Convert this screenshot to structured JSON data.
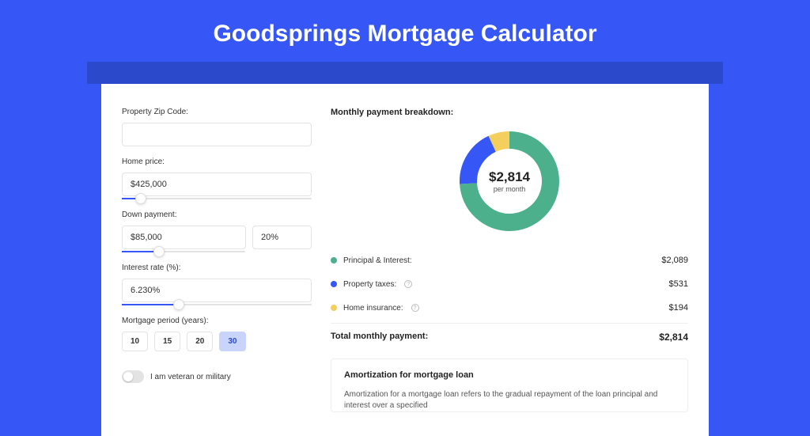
{
  "title": "Goodsprings Mortgage Calculator",
  "colors": {
    "primary": "#3656f5",
    "green": "#4cb08c",
    "blue": "#3656f5",
    "yellow": "#f4cf5d"
  },
  "form": {
    "zip_label": "Property Zip Code:",
    "zip_value": "",
    "home_price_label": "Home price:",
    "home_price_value": "$425,000",
    "home_price_slider_pct": 10,
    "down_payment_label": "Down payment:",
    "down_payment_value": "$85,000",
    "down_payment_pct": "20%",
    "down_payment_slider_pct": 20,
    "interest_label": "Interest rate (%):",
    "interest_value": "6.230%",
    "interest_slider_pct": 30,
    "period_label": "Mortgage period (years):",
    "periods": [
      "10",
      "15",
      "20",
      "30"
    ],
    "period_active_index": 3,
    "veteran_label": "I am veteran or military"
  },
  "breakdown": {
    "title": "Monthly payment breakdown:",
    "total": "$2,814",
    "per": "per month",
    "items": [
      {
        "label": "Principal & Interest:",
        "value": "$2,089",
        "color": "#4cb08c",
        "info": false,
        "pct": 74
      },
      {
        "label": "Property taxes:",
        "value": "$531",
        "color": "#3656f5",
        "info": true,
        "pct": 19
      },
      {
        "label": "Home insurance:",
        "value": "$194",
        "color": "#f4cf5d",
        "info": true,
        "pct": 7
      }
    ],
    "total_label": "Total monthly payment:",
    "total_value": "$2,814"
  },
  "amort": {
    "title": "Amortization for mortgage loan",
    "text": "Amortization for a mortgage loan refers to the gradual repayment of the loan principal and interest over a specified"
  }
}
